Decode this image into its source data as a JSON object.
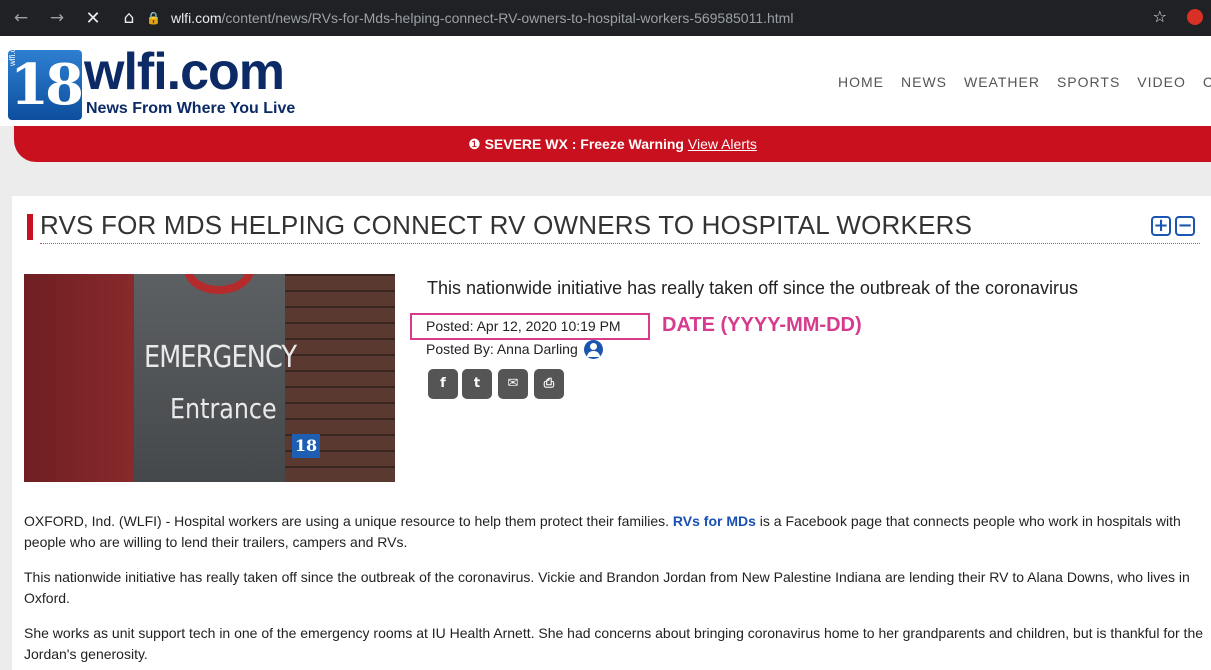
{
  "browser": {
    "back_icon": "←",
    "forward_icon": "→",
    "stop_icon": "✕",
    "home_icon": "⌂",
    "lock_icon": "🔒",
    "url_host": "wlfi.com",
    "url_path": "/content/news/RVs-for-Mds-helping-connect-RV-owners-to-hospital-workers-569585011.html",
    "star_icon": "☆"
  },
  "site": {
    "logo_number": "18",
    "logo_side_text": "wlfi.com",
    "logo_name": "wlfi.com",
    "tagline": "News From Where You Live",
    "nav": [
      "HOME",
      "NEWS",
      "WEATHER",
      "SPORTS",
      "VIDEO",
      "CO"
    ]
  },
  "alert": {
    "icon": "❶",
    "label": "SEVERE WX : Freeze Warning",
    "link": "View Alerts"
  },
  "article": {
    "headline": "RVS FOR MDS HELPING CONNECT RV OWNERS TO HOSPITAL WORKERS",
    "expand_icon": "+",
    "collapse_icon": "−",
    "photo_sign_1": "EMERGENCY",
    "photo_sign_2": "Entrance",
    "photo_watermark": "18",
    "subhead": "This nationwide initiative has really taken off since the outbreak of the coronavirus",
    "posted": "Posted: Apr 12, 2020 10:19 PM",
    "date_annotation": "DATE (YYYY-MM-DD)",
    "byline": "Posted By: Anna Darling",
    "share": {
      "facebook": "f",
      "twitter": "t",
      "email": "✉",
      "print": "⎙"
    },
    "p1_before": "OXFORD, Ind. (WLFI) - Hospital workers are using a unique resource to help them protect their families. ",
    "p1_link": "RVs for MDs",
    "p1_after": " is a Facebook page that connects people who work in hospitals with people who are willing to lend their trailers, campers and RVs.",
    "p2": "This nationwide initiative has really taken off since the outbreak of the coronavirus. Vickie and Brandon Jordan from New Palestine Indiana are lending their RV to Alana Downs, who lives in Oxford.",
    "p3": "She works as unit support tech in one of the emergency rooms at IU Health Arnett. She had concerns about bringing coronavirus home to her grandparents and children, but is thankful for the Jordan's generosity."
  },
  "colors": {
    "brand_red": "#c8101e",
    "brand_navy": "#0b2a66",
    "link_blue": "#1a4fb5",
    "annotation_pink": "#d63b8e"
  }
}
